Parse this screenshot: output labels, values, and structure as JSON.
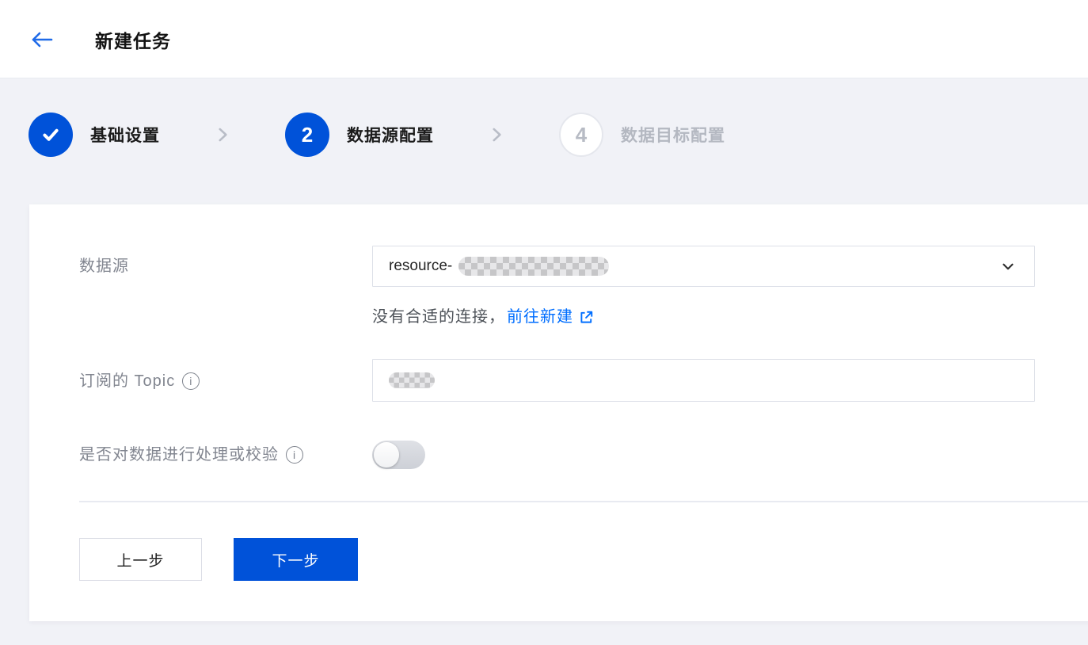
{
  "header": {
    "title": "新建任务"
  },
  "steps": {
    "items": [
      {
        "indicator": "check",
        "label": "基础设置",
        "state": "done"
      },
      {
        "indicator": "2",
        "label": "数据源配置",
        "state": "active"
      },
      {
        "indicator": "4",
        "label": "数据目标配置",
        "state": "pending"
      }
    ]
  },
  "form": {
    "datasource": {
      "label": "数据源",
      "value_prefix": "resource-",
      "value_redacted": true
    },
    "datasource_help": {
      "text": "没有合适的连接，",
      "link_label": "前往新建"
    },
    "topic": {
      "label": "订阅的 Topic",
      "info_glyph": "i",
      "value_redacted": true
    },
    "process": {
      "label": "是否对数据进行处理或校验",
      "info_glyph": "i",
      "toggle_state": "off"
    }
  },
  "footer": {
    "prev_label": "上一步",
    "next_label": "下一步"
  },
  "colors": {
    "primary_blue": "#0052d9",
    "link_blue": "#006eff",
    "page_background": "#f1f2f7",
    "label_gray": "#828690",
    "pending_gray": "#b4b8c1"
  }
}
